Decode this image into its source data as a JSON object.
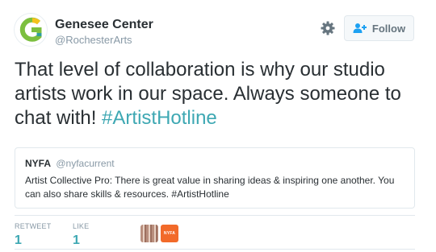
{
  "account": {
    "display_name": "Genesee Center",
    "handle": "@RochesterArts",
    "avatar_icon": "genesee-g-logo"
  },
  "actions": {
    "settings_icon": "gear-icon",
    "follow_icon": "add-user-icon",
    "follow_label": "Follow"
  },
  "tweet": {
    "text": "That level of collaboration is why our studio artists work in our space. Always someone to chat with! ",
    "hashtag": "#ArtistHotline"
  },
  "quoted_tweet": {
    "name": "NYFA",
    "handle": "@nyfacurrent",
    "text": "Artist Collective Pro: There is great value in sharing ideas & inspiring one another. You can also share skills & resources. #ArtistHotline"
  },
  "stats": {
    "retweet_label": "RETWEET",
    "retweet_count": "1",
    "like_label": "LIKE",
    "like_count": "1"
  },
  "likers": [
    {
      "name": "liker-avatar-1"
    },
    {
      "name": "liker-avatar-2",
      "label": "NYFA"
    }
  ],
  "colors": {
    "accent": "#3ea8b3",
    "logo_green": "#7cbf3f",
    "logo_teal": "#2f9e9c",
    "logo_yellow": "#f4c21c",
    "muted": "#8899a6"
  }
}
